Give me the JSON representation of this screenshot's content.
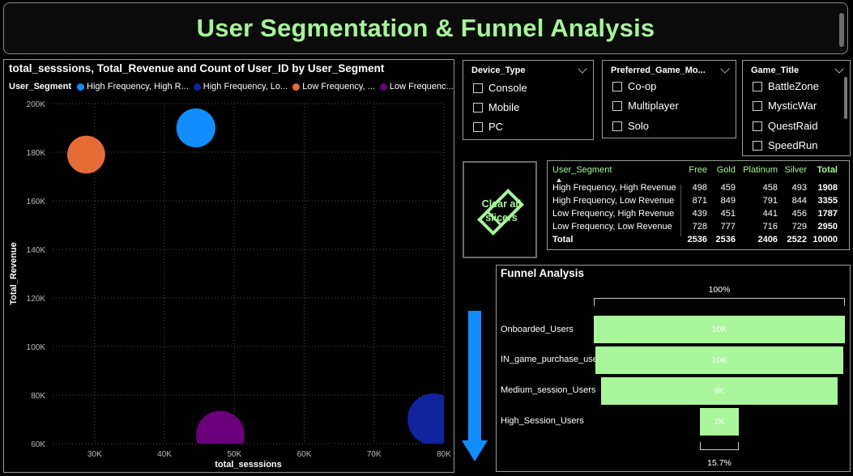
{
  "header": {
    "title": "User Segmentation & Funnel Analysis"
  },
  "scatter": {
    "title": "total_sesssions, Total_Revenue and Count of User_ID by User_Segment",
    "legend_title": "User_Segment",
    "legend": [
      {
        "label": "High Frequency, High R...",
        "color": "#118DFF"
      },
      {
        "label": "High Frequency, Lo...",
        "color": "#12239E"
      },
      {
        "label": "Low Frequency, ...",
        "color": "#E66C37"
      },
      {
        "label": "Low Frequenc...",
        "color": "#6B007B"
      }
    ]
  },
  "chart_data": {
    "type": "scatter",
    "title": "total_sesssions, Total_Revenue and Count of User_ID by User_Segment",
    "xlabel": "total_sesssions",
    "ylabel": "Total_Revenue",
    "xlim": [
      24000,
      80000
    ],
    "ylim": [
      60000,
      200000
    ],
    "x_ticks": [
      30000,
      40000,
      50000,
      60000,
      70000,
      80000
    ],
    "x_tick_labels": [
      "30K",
      "40K",
      "50K",
      "60K",
      "70K",
      "80K"
    ],
    "y_ticks": [
      60000,
      80000,
      100000,
      120000,
      140000,
      160000,
      180000,
      200000
    ],
    "y_tick_labels": [
      "60K",
      "80K",
      "100K",
      "120K",
      "140K",
      "160K",
      "180K",
      "200K"
    ],
    "grid": true,
    "legend_position": "top-left",
    "series": [
      {
        "name": "High Frequency, High R...",
        "color": "#118DFF",
        "x": 44500,
        "y": 190000,
        "size": 1908
      },
      {
        "name": "High Frequency, Lo...",
        "color": "#12239E",
        "x": 78500,
        "y": 70000,
        "size": 3355
      },
      {
        "name": "Low Frequency, ...",
        "color": "#E66C37",
        "x": 28800,
        "y": 179000,
        "size": 1787
      },
      {
        "name": "Low Frequenc...",
        "color": "#6B007B",
        "x": 48000,
        "y": 63500,
        "size": 2950
      }
    ]
  },
  "slicers": {
    "device": {
      "title": "Device_Type",
      "options": [
        "Console",
        "Mobile",
        "PC"
      ]
    },
    "mode": {
      "title": "Preferred_Game_Mo...",
      "options": [
        "Co-op",
        "Multiplayer",
        "Solo"
      ]
    },
    "game": {
      "title": "Game_Title",
      "options": [
        "BattleZone",
        "MysticWar",
        "QuestRaid",
        "SpeedRun"
      ]
    }
  },
  "clear_button": {
    "line1": "Clear all",
    "line2": "slicers"
  },
  "matrix": {
    "headers": [
      "User_Segment",
      "Free",
      "Gold",
      "Platinum",
      "Silver",
      "Total"
    ],
    "rows": [
      [
        "High Frequency, High Revenue",
        "498",
        "459",
        "458",
        "493",
        "1908"
      ],
      [
        "High Frequency, Low Revenue",
        "871",
        "849",
        "791",
        "844",
        "3355"
      ],
      [
        "Low Frequency, High Revenue",
        "439",
        "451",
        "441",
        "456",
        "1787"
      ],
      [
        "Low Frequency, Low Revenue",
        "728",
        "777",
        "716",
        "729",
        "2950"
      ]
    ],
    "total_row": [
      "Total",
      "2536",
      "2536",
      "2406",
      "2522",
      "10000"
    ]
  },
  "funnel": {
    "title": "Funnel Analysis",
    "top_pct": "100%",
    "bottom_pct": "15.7%",
    "stages": [
      {
        "label": "Onboarded_Users",
        "value_label": "10K",
        "fraction": 1.0
      },
      {
        "label": "IN_game_purchase_users",
        "value_label": "10K",
        "fraction": 0.99
      },
      {
        "label": "Medium_session_Users",
        "value_label": "9K",
        "fraction": 0.94
      },
      {
        "label": "High_Session_Users",
        "value_label": "2K",
        "fraction": 0.157
      }
    ],
    "bar_color": "#A9F69C"
  },
  "colors": {
    "accent": "#A6F59A",
    "arrow": "#118DFF"
  }
}
